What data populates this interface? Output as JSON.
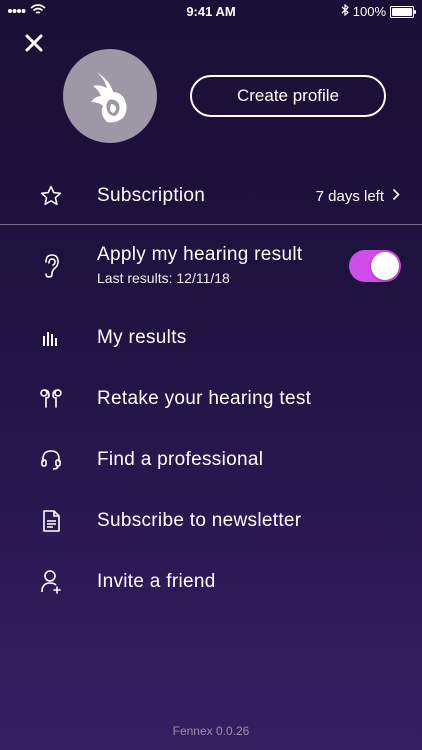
{
  "status_bar": {
    "time": "9:41 AM",
    "battery": "100%"
  },
  "header": {
    "close_icon": "close-icon",
    "avatar_icon": "fennex-logo",
    "create_profile_label": "Create profile"
  },
  "subscription": {
    "label": "Subscription",
    "status": "7 days left",
    "icon": "star-icon"
  },
  "hearing": {
    "label": "Apply my hearing result",
    "last_results": "Last results: 12/11/18",
    "toggle_on": true,
    "toggle_color": "#d04ee8",
    "icon": "ear-icon"
  },
  "menu": [
    {
      "label": "My results",
      "icon": "bar-chart-icon"
    },
    {
      "label": "Retake your hearing test",
      "icon": "earbuds-icon"
    },
    {
      "label": "Find a professional",
      "icon": "headset-icon"
    },
    {
      "label": "Subscribe to newsletter",
      "icon": "document-icon"
    },
    {
      "label": "Invite a friend",
      "icon": "add-user-icon"
    }
  ],
  "footer": {
    "version": "Fennex 0.0.26"
  }
}
